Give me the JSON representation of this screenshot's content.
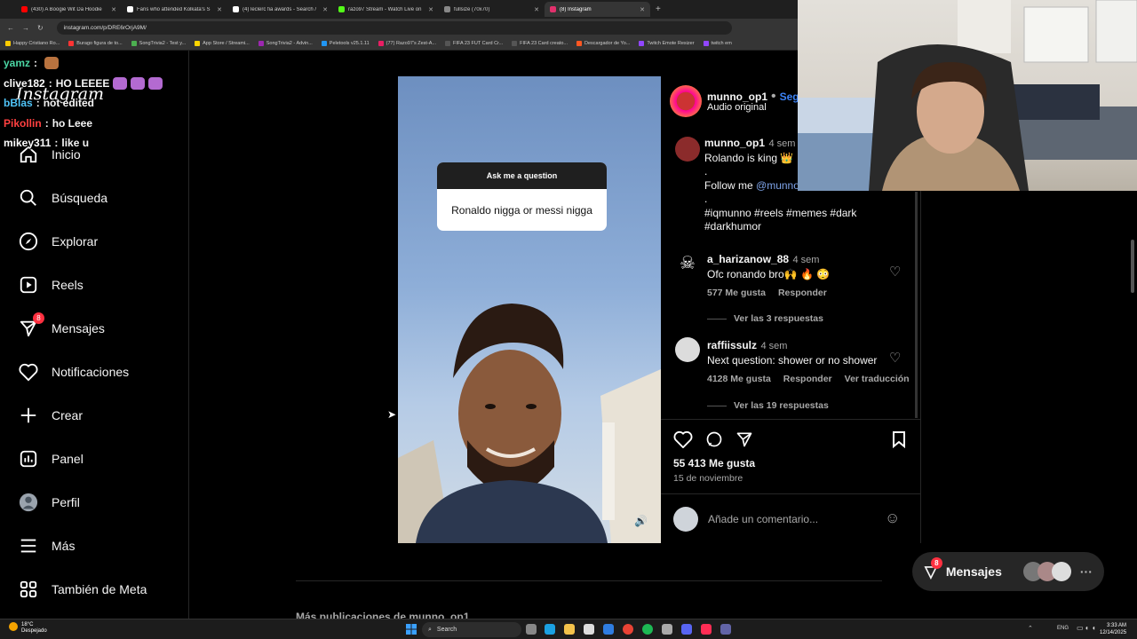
{
  "browser": {
    "tabs": [
      {
        "label": "(430) A Boogie Wit Da Hoodie",
        "color": "#ff0000",
        "active": false
      },
      {
        "label": "Fans who attended Kolkata's S",
        "color": "#ffffff",
        "active": false
      },
      {
        "label": "(4) leclerc fia awards - Search /",
        "color": "#ffffff",
        "active": false
      },
      {
        "label": "razo97 Stream - Watch Live on",
        "color": "#53fc18",
        "active": false
      },
      {
        "label": "fullsize (70x70)",
        "color": "#888888",
        "active": false
      },
      {
        "label": "(8) Instagram",
        "color": "#e1306c",
        "active": true
      }
    ],
    "url": "instagram.com/p/DRE6rOrjA9M/",
    "bookmarks": [
      {
        "label": "Happy Cristiano Ro...",
        "color": "#ffcc00"
      },
      {
        "label": "Burago figura de to...",
        "color": "#ff3333"
      },
      {
        "label": "SongTrivia2 - Test y...",
        "color": "#4caf50"
      },
      {
        "label": "App Store / Streami...",
        "color": "#ffd600"
      },
      {
        "label": "SongTrivia2 - Advin...",
        "color": "#9c27b0"
      },
      {
        "label": "Peletools v25.1.11",
        "color": "#2196f3"
      },
      {
        "label": "(77) Razo97's Zest-A...",
        "color": "#e91e63"
      },
      {
        "label": "FIFA 23 FUT Card Cr...",
        "color": "#555555"
      },
      {
        "label": "FIFA 23 Card creato...",
        "color": "#555555"
      },
      {
        "label": "Descargador de Yo...",
        "color": "#ff5722"
      },
      {
        "label": "Twitch Emote Resizer",
        "color": "#9146ff"
      },
      {
        "label": "twitch em",
        "color": "#9146ff"
      }
    ]
  },
  "chat": [
    {
      "user": "yamz",
      "text": "",
      "color": "#4bd6a4"
    },
    {
      "user": "clive182",
      "text": "HO LEEEE",
      "color": "#ffffff"
    },
    {
      "user": "bBlas",
      "text": "not edited",
      "color": "#4fc3f7"
    },
    {
      "user": "Pikollin",
      "text": "ho Leee",
      "color": "#ff4040"
    },
    {
      "user": "mikey311",
      "text": "like u",
      "color": "#ffffff"
    }
  ],
  "sidebar": {
    "logo": "Instagram",
    "items": [
      {
        "label": "Inicio",
        "icon": "home-icon"
      },
      {
        "label": "Búsqueda",
        "icon": "search-icon"
      },
      {
        "label": "Explorar",
        "icon": "compass-icon"
      },
      {
        "label": "Reels",
        "icon": "reels-icon"
      },
      {
        "label": "Mensajes",
        "icon": "messages-icon",
        "badge": "8"
      },
      {
        "label": "Notificaciones",
        "icon": "heart-icon"
      },
      {
        "label": "Crear",
        "icon": "plus-icon"
      },
      {
        "label": "Panel",
        "icon": "chart-icon"
      },
      {
        "label": "Perfil",
        "icon": "avatar-icon"
      },
      {
        "label": "Más",
        "icon": "menu-icon"
      },
      {
        "label": "También de Meta",
        "icon": "meta-icon"
      }
    ]
  },
  "post": {
    "question_header": "Ask me a question",
    "question_text": "Ronaldo nigga or messi nigga",
    "author": "munno_op1",
    "follow": "Segu",
    "audio": "Audio original",
    "caption": {
      "user": "munno_op1",
      "time": "4 sem",
      "line1": "Rolando is king 👑",
      "dot": ".",
      "follow_prefix": "Follow me",
      "follow_handle": "@munno",
      "dot2": ".",
      "hashtags_1": "#iqmunno #reels #memes #dark",
      "hashtags_2": "#darkhumor"
    },
    "comments": [
      {
        "user": "a_harizanow_88",
        "time": "4 sem",
        "text": "Ofc ronando bro🙌 🔥 😳",
        "likes": "577 Me gusta",
        "reply": "Responder",
        "translate": "",
        "replies": "Ver las 3 respuestas"
      },
      {
        "user": "raffiissulz",
        "time": "4 sem",
        "text": "Next question: shower or no shower",
        "likes": "4128 Me gusta",
        "reply": "Responder",
        "translate": "Ver traducción",
        "replies": "Ver las 19 respuestas"
      }
    ],
    "likes": "55 413 Me gusta",
    "date": "15 de noviembre",
    "comment_placeholder": "Añade un comentario..."
  },
  "floating_messages": {
    "label": "Mensajes",
    "badge": "8"
  },
  "footer_partial": "Más publicaciones de munno_op1",
  "taskbar": {
    "weather_temp": "18°C",
    "weather_desc": "Despejado",
    "search": "Search",
    "lang": "ENG",
    "time": "3:33 AM",
    "date": "12/14/2025"
  }
}
